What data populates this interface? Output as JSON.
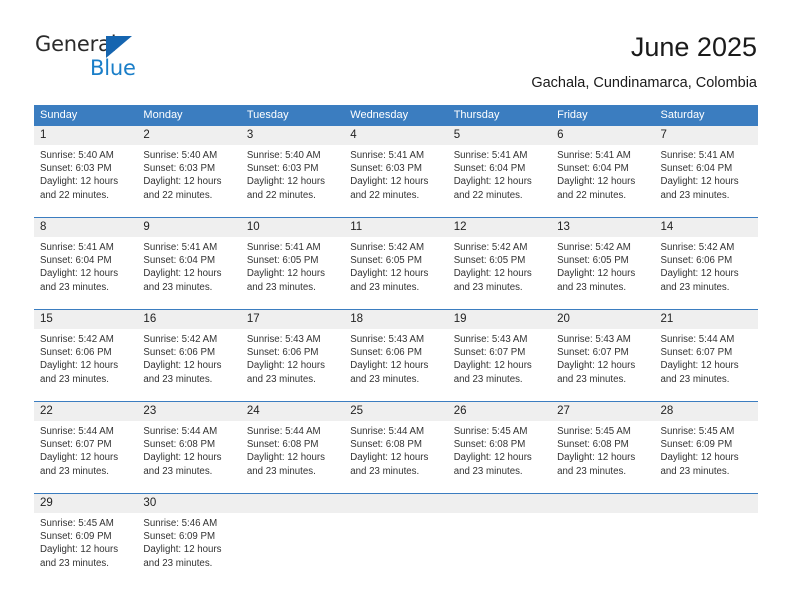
{
  "brand": {
    "name_top": "General",
    "name_bottom": "Blue",
    "accent_color": "#1a7ec8",
    "triangle_color": "#1565b0"
  },
  "header": {
    "title": "June 2025",
    "subtitle": "Gachala, Cundinamarca, Colombia",
    "header_bg_color": "#3b7dc0",
    "daynum_bg_color": "#efefef"
  },
  "weekday_headers": [
    "Sunday",
    "Monday",
    "Tuesday",
    "Wednesday",
    "Thursday",
    "Friday",
    "Saturday"
  ],
  "labels": {
    "sunrise_prefix": "Sunrise:",
    "sunset_prefix": "Sunset:",
    "daylight_prefix": "Daylight:"
  },
  "weeks": [
    [
      {
        "day": "1",
        "sunrise": "Sunrise: 5:40 AM",
        "sunset": "Sunset: 6:03 PM",
        "daylight1": "Daylight: 12 hours",
        "daylight2": "and 22 minutes."
      },
      {
        "day": "2",
        "sunrise": "Sunrise: 5:40 AM",
        "sunset": "Sunset: 6:03 PM",
        "daylight1": "Daylight: 12 hours",
        "daylight2": "and 22 minutes."
      },
      {
        "day": "3",
        "sunrise": "Sunrise: 5:40 AM",
        "sunset": "Sunset: 6:03 PM",
        "daylight1": "Daylight: 12 hours",
        "daylight2": "and 22 minutes."
      },
      {
        "day": "4",
        "sunrise": "Sunrise: 5:41 AM",
        "sunset": "Sunset: 6:03 PM",
        "daylight1": "Daylight: 12 hours",
        "daylight2": "and 22 minutes."
      },
      {
        "day": "5",
        "sunrise": "Sunrise: 5:41 AM",
        "sunset": "Sunset: 6:04 PM",
        "daylight1": "Daylight: 12 hours",
        "daylight2": "and 22 minutes."
      },
      {
        "day": "6",
        "sunrise": "Sunrise: 5:41 AM",
        "sunset": "Sunset: 6:04 PM",
        "daylight1": "Daylight: 12 hours",
        "daylight2": "and 22 minutes."
      },
      {
        "day": "7",
        "sunrise": "Sunrise: 5:41 AM",
        "sunset": "Sunset: 6:04 PM",
        "daylight1": "Daylight: 12 hours",
        "daylight2": "and 23 minutes."
      }
    ],
    [
      {
        "day": "8",
        "sunrise": "Sunrise: 5:41 AM",
        "sunset": "Sunset: 6:04 PM",
        "daylight1": "Daylight: 12 hours",
        "daylight2": "and 23 minutes."
      },
      {
        "day": "9",
        "sunrise": "Sunrise: 5:41 AM",
        "sunset": "Sunset: 6:04 PM",
        "daylight1": "Daylight: 12 hours",
        "daylight2": "and 23 minutes."
      },
      {
        "day": "10",
        "sunrise": "Sunrise: 5:41 AM",
        "sunset": "Sunset: 6:05 PM",
        "daylight1": "Daylight: 12 hours",
        "daylight2": "and 23 minutes."
      },
      {
        "day": "11",
        "sunrise": "Sunrise: 5:42 AM",
        "sunset": "Sunset: 6:05 PM",
        "daylight1": "Daylight: 12 hours",
        "daylight2": "and 23 minutes."
      },
      {
        "day": "12",
        "sunrise": "Sunrise: 5:42 AM",
        "sunset": "Sunset: 6:05 PM",
        "daylight1": "Daylight: 12 hours",
        "daylight2": "and 23 minutes."
      },
      {
        "day": "13",
        "sunrise": "Sunrise: 5:42 AM",
        "sunset": "Sunset: 6:05 PM",
        "daylight1": "Daylight: 12 hours",
        "daylight2": "and 23 minutes."
      },
      {
        "day": "14",
        "sunrise": "Sunrise: 5:42 AM",
        "sunset": "Sunset: 6:06 PM",
        "daylight1": "Daylight: 12 hours",
        "daylight2": "and 23 minutes."
      }
    ],
    [
      {
        "day": "15",
        "sunrise": "Sunrise: 5:42 AM",
        "sunset": "Sunset: 6:06 PM",
        "daylight1": "Daylight: 12 hours",
        "daylight2": "and 23 minutes."
      },
      {
        "day": "16",
        "sunrise": "Sunrise: 5:42 AM",
        "sunset": "Sunset: 6:06 PM",
        "daylight1": "Daylight: 12 hours",
        "daylight2": "and 23 minutes."
      },
      {
        "day": "17",
        "sunrise": "Sunrise: 5:43 AM",
        "sunset": "Sunset: 6:06 PM",
        "daylight1": "Daylight: 12 hours",
        "daylight2": "and 23 minutes."
      },
      {
        "day": "18",
        "sunrise": "Sunrise: 5:43 AM",
        "sunset": "Sunset: 6:06 PM",
        "daylight1": "Daylight: 12 hours",
        "daylight2": "and 23 minutes."
      },
      {
        "day": "19",
        "sunrise": "Sunrise: 5:43 AM",
        "sunset": "Sunset: 6:07 PM",
        "daylight1": "Daylight: 12 hours",
        "daylight2": "and 23 minutes."
      },
      {
        "day": "20",
        "sunrise": "Sunrise: 5:43 AM",
        "sunset": "Sunset: 6:07 PM",
        "daylight1": "Daylight: 12 hours",
        "daylight2": "and 23 minutes."
      },
      {
        "day": "21",
        "sunrise": "Sunrise: 5:44 AM",
        "sunset": "Sunset: 6:07 PM",
        "daylight1": "Daylight: 12 hours",
        "daylight2": "and 23 minutes."
      }
    ],
    [
      {
        "day": "22",
        "sunrise": "Sunrise: 5:44 AM",
        "sunset": "Sunset: 6:07 PM",
        "daylight1": "Daylight: 12 hours",
        "daylight2": "and 23 minutes."
      },
      {
        "day": "23",
        "sunrise": "Sunrise: 5:44 AM",
        "sunset": "Sunset: 6:08 PM",
        "daylight1": "Daylight: 12 hours",
        "daylight2": "and 23 minutes."
      },
      {
        "day": "24",
        "sunrise": "Sunrise: 5:44 AM",
        "sunset": "Sunset: 6:08 PM",
        "daylight1": "Daylight: 12 hours",
        "daylight2": "and 23 minutes."
      },
      {
        "day": "25",
        "sunrise": "Sunrise: 5:44 AM",
        "sunset": "Sunset: 6:08 PM",
        "daylight1": "Daylight: 12 hours",
        "daylight2": "and 23 minutes."
      },
      {
        "day": "26",
        "sunrise": "Sunrise: 5:45 AM",
        "sunset": "Sunset: 6:08 PM",
        "daylight1": "Daylight: 12 hours",
        "daylight2": "and 23 minutes."
      },
      {
        "day": "27",
        "sunrise": "Sunrise: 5:45 AM",
        "sunset": "Sunset: 6:08 PM",
        "daylight1": "Daylight: 12 hours",
        "daylight2": "and 23 minutes."
      },
      {
        "day": "28",
        "sunrise": "Sunrise: 5:45 AM",
        "sunset": "Sunset: 6:09 PM",
        "daylight1": "Daylight: 12 hours",
        "daylight2": "and 23 minutes."
      }
    ],
    [
      {
        "day": "29",
        "sunrise": "Sunrise: 5:45 AM",
        "sunset": "Sunset: 6:09 PM",
        "daylight1": "Daylight: 12 hours",
        "daylight2": "and 23 minutes."
      },
      {
        "day": "30",
        "sunrise": "Sunrise: 5:46 AM",
        "sunset": "Sunset: 6:09 PM",
        "daylight1": "Daylight: 12 hours",
        "daylight2": "and 23 minutes."
      },
      {
        "day": "",
        "sunrise": "",
        "sunset": "",
        "daylight1": "",
        "daylight2": ""
      },
      {
        "day": "",
        "sunrise": "",
        "sunset": "",
        "daylight1": "",
        "daylight2": ""
      },
      {
        "day": "",
        "sunrise": "",
        "sunset": "",
        "daylight1": "",
        "daylight2": ""
      },
      {
        "day": "",
        "sunrise": "",
        "sunset": "",
        "daylight1": "",
        "daylight2": ""
      },
      {
        "day": "",
        "sunrise": "",
        "sunset": "",
        "daylight1": "",
        "daylight2": ""
      }
    ]
  ]
}
